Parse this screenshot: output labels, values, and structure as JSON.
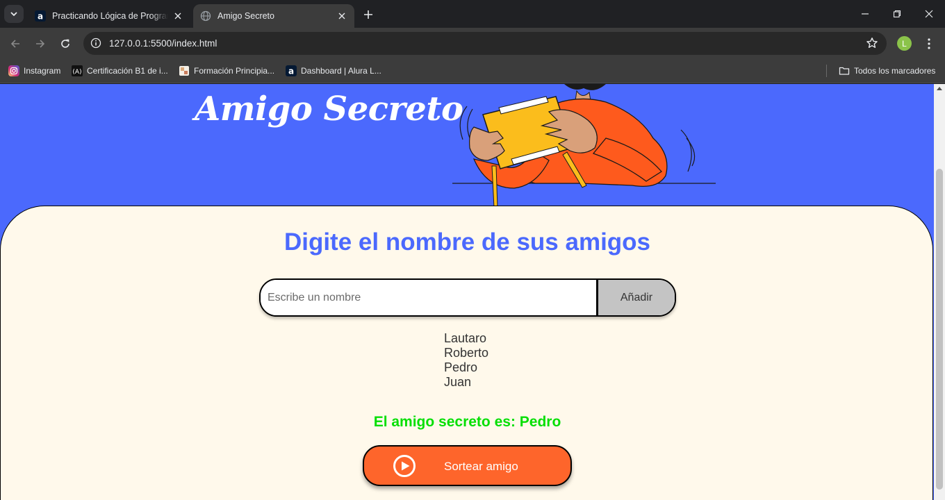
{
  "browser": {
    "tabs": [
      {
        "title": "Practicando Lógica de Programa",
        "active": false
      },
      {
        "title": "Amigo Secreto",
        "active": true
      }
    ],
    "url": "127.0.0.1:5500/index.html",
    "profile_initial": "L",
    "bookmarks": [
      {
        "label": "Instagram",
        "icon": "instagram-icon"
      },
      {
        "label": "Certificación B1 de i...",
        "icon": "certification-icon"
      },
      {
        "label": "Formación Principia...",
        "icon": "page-icon"
      },
      {
        "label": "Dashboard | Alura L...",
        "icon": "alura-icon"
      }
    ],
    "all_bookmarks_label": "Todos los marcadores"
  },
  "page": {
    "hero_title": "Amigo Secreto",
    "section_title": "Digite el nombre de sus amigos",
    "input_placeholder": "Escribe un nombre",
    "input_value": "",
    "add_button_label": "Añadir",
    "friends": [
      "Lautaro",
      "Roberto",
      "Pedro",
      "Juan"
    ],
    "result_text": "El amigo secreto es: Pedro",
    "draw_button_label": "Sortear amigo"
  },
  "colors": {
    "primary_blue": "#4b69fd",
    "card_background": "#fff9eb",
    "result_green": "#05df05",
    "draw_button_orange": "#fe652b",
    "add_button_gray": "#c4c4c4"
  }
}
